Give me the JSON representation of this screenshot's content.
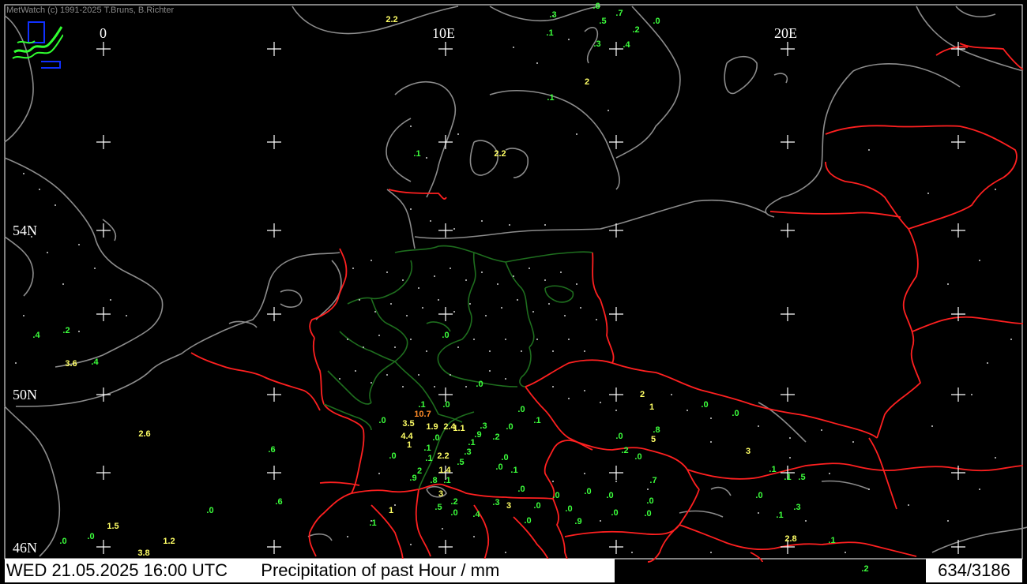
{
  "header": {
    "credit": "MetWatch  (c) 1991-2025 T.Bruns, B.Richter"
  },
  "grid_labels": {
    "lon_0": "0",
    "lon_10": "10E",
    "lon_20": "20E",
    "lat_54": "54N",
    "lat_50": "50N",
    "lat_46": "46N"
  },
  "footer": {
    "datetime": "WED 21.05.2025 16:00 UTC",
    "title": "Precipitation of past  Hour  / mm",
    "count": "634/3186"
  },
  "colors": {
    "background": "#000000",
    "coastline": "#8c8c8c",
    "country_border": "#ff2020",
    "state_border": "#1e6e1e",
    "grid_cross": "#ffffff",
    "value_low": "#3cff3c",
    "value_mid": "#ffff66",
    "value_high": "#ff8c28"
  },
  "icons": {
    "logo": "metwatch-logo-icon"
  },
  "legend_note": "",
  "observations": [
    {
      "v": ".6",
      "c": "g"
    },
    {
      "v": ".7",
      "c": "g"
    },
    {
      "v": ".3",
      "c": "g"
    },
    {
      "v": ".5",
      "c": "g"
    },
    {
      "v": ".2",
      "c": "g"
    },
    {
      "v": ".0",
      "c": "g"
    },
    {
      "v": ".1",
      "c": "g"
    },
    {
      "v": ".3",
      "c": "g"
    },
    {
      "v": ".4",
      "c": "g"
    },
    {
      "v": "2",
      "c": "y"
    },
    {
      "v": ".1",
      "c": "g"
    },
    {
      "v": "2.2",
      "c": "y"
    },
    {
      "v": ".1",
      "c": "g"
    },
    {
      "v": "2.2",
      "c": "y"
    },
    {
      "v": ".4",
      "c": "g"
    },
    {
      "v": ".2",
      "c": "g"
    },
    {
      "v": "3.6",
      "c": "y"
    },
    {
      "v": ".4",
      "c": "g"
    },
    {
      "v": "2.6",
      "c": "y"
    },
    {
      "v": ".6",
      "c": "g"
    },
    {
      "v": ".6",
      "c": "g"
    },
    {
      "v": ".0",
      "c": "g"
    },
    {
      "v": "1.5",
      "c": "y"
    },
    {
      "v": ".0",
      "c": "g"
    },
    {
      "v": ".0",
      "c": "g"
    },
    {
      "v": "1.2",
      "c": "y"
    },
    {
      "v": "3.8",
      "c": "y"
    },
    {
      "v": ".0",
      "c": "g"
    },
    {
      "v": ".0",
      "c": "g"
    },
    {
      "v": ".1",
      "c": "g"
    },
    {
      "v": ".0",
      "c": "g"
    },
    {
      "v": "10.7",
      "c": "o"
    },
    {
      "v": "3.5",
      "c": "y"
    },
    {
      "v": ".0",
      "c": "g"
    },
    {
      "v": "1.9",
      "c": "y"
    },
    {
      "v": "2.4",
      "c": "y"
    },
    {
      "v": "1.1",
      "c": "y"
    },
    {
      "v": "4.4",
      "c": "y"
    },
    {
      "v": ".0",
      "c": "g"
    },
    {
      "v": "1",
      "c": "y"
    },
    {
      "v": ".1",
      "c": "g"
    },
    {
      "v": ".0",
      "c": "g"
    },
    {
      "v": ".1",
      "c": "g"
    },
    {
      "v": "2.2",
      "c": "y"
    },
    {
      "v": ".5",
      "c": "g"
    },
    {
      "v": "2",
      "c": "g"
    },
    {
      "v": "1.4",
      "c": "y"
    },
    {
      "v": ".9",
      "c": "g"
    },
    {
      "v": ".8",
      "c": "g"
    },
    {
      "v": ".1",
      "c": "g"
    },
    {
      "v": ".3",
      "c": "g"
    },
    {
      "v": ".1",
      "c": "g"
    },
    {
      "v": "3",
      "c": "y"
    },
    {
      "v": ".2",
      "c": "g"
    },
    {
      "v": ".5",
      "c": "g"
    },
    {
      "v": ".0",
      "c": "g"
    },
    {
      "v": "1",
      "c": "y"
    },
    {
      "v": ".1",
      "c": "g"
    },
    {
      "v": ".0",
      "c": "g"
    },
    {
      "v": ".1",
      "c": "g"
    },
    {
      "v": ".9",
      "c": "g"
    },
    {
      "v": ".2",
      "c": "g"
    },
    {
      "v": ".3",
      "c": "g"
    },
    {
      "v": ".0",
      "c": "g"
    },
    {
      "v": ".0",
      "c": "g"
    },
    {
      "v": ".0",
      "c": "g"
    },
    {
      "v": ".1",
      "c": "g"
    },
    {
      "v": ".0",
      "c": "g"
    },
    {
      "v": ".0",
      "c": "g"
    },
    {
      "v": ".0",
      "c": "g"
    },
    {
      "v": ".3",
      "c": "g"
    },
    {
      "v": "3",
      "c": "y"
    },
    {
      "v": ".4",
      "c": "g"
    },
    {
      "v": "2",
      "c": "y"
    },
    {
      "v": "1",
      "c": "y"
    },
    {
      "v": ".0",
      "c": "g"
    },
    {
      "v": ".0",
      "c": "g"
    },
    {
      "v": ".8",
      "c": "g"
    },
    {
      "v": ".0",
      "c": "g"
    },
    {
      "v": "5",
      "c": "y"
    },
    {
      "v": ".2",
      "c": "g"
    },
    {
      "v": ".0",
      "c": "g"
    },
    {
      "v": "3",
      "c": "y"
    },
    {
      "v": ".7",
      "c": "g"
    },
    {
      "v": ".1",
      "c": "g"
    },
    {
      "v": ".1",
      "c": "g"
    },
    {
      "v": ".5",
      "c": "g"
    },
    {
      "v": ".0",
      "c": "g"
    },
    {
      "v": ".0",
      "c": "g"
    },
    {
      "v": ".0",
      "c": "g"
    },
    {
      "v": ".0",
      "c": "g"
    },
    {
      "v": ".0",
      "c": "g"
    },
    {
      "v": ".9",
      "c": "g"
    },
    {
      "v": ".0",
      "c": "g"
    },
    {
      "v": ".0",
      "c": "g"
    },
    {
      "v": ".0",
      "c": "g"
    },
    {
      "v": ".1",
      "c": "g"
    },
    {
      "v": ".3",
      "c": "g"
    },
    {
      "v": ".1",
      "c": "g"
    },
    {
      "v": "2.8",
      "c": "y"
    },
    {
      "v": ".2",
      "c": "g"
    }
  ]
}
